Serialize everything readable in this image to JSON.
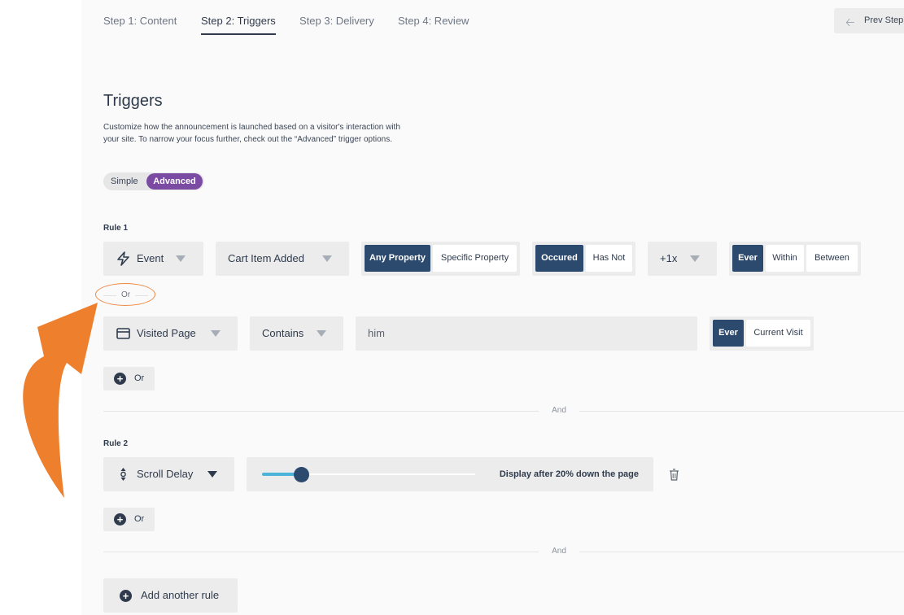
{
  "tabs": [
    {
      "label": "Step 1: Content"
    },
    {
      "label": "Step 2: Triggers"
    },
    {
      "label": "Step 3: Delivery"
    },
    {
      "label": "Step 4: Review"
    }
  ],
  "prev_step": "Prev Step",
  "title": "Triggers",
  "description": "Customize how the announcement is launched based on a visitor's interaction with your site. To narrow your focus further, check out the “Advanced” trigger options.",
  "mode": {
    "simple": "Simple",
    "advanced": "Advanced",
    "selected": "Advanced"
  },
  "rule1": {
    "label": "Rule 1",
    "event_type": "Event",
    "event_value": "Cart Item Added",
    "property": {
      "options": [
        "Any Property",
        "Specific Property"
      ],
      "selected": "Any Property"
    },
    "occurrence": {
      "options": [
        "Occured",
        "Has Not"
      ],
      "selected": "Occured"
    },
    "count": "+1x",
    "timeframe": {
      "options": [
        "Ever",
        "Within",
        "Between"
      ],
      "selected": "Ever"
    },
    "or_label": "Or",
    "condition2": {
      "type": "Visited Page",
      "operator": "Contains",
      "value": "him",
      "scope": {
        "options": [
          "Ever",
          "Current Visit"
        ],
        "selected": "Ever"
      }
    },
    "add_or": "Or"
  },
  "and_label": "And",
  "rule2": {
    "label": "Rule 2",
    "type": "Scroll Delay",
    "slider_percent": 20,
    "slider_text": "Display after 20% down the page",
    "add_or": "Or"
  },
  "add_rule": "Add another rule",
  "colors": {
    "accent": "#7b4aa3",
    "selected": "#2c4a6e",
    "annotation_arrow": "#ee7f2d",
    "slider_fill": "#4cb3d9"
  }
}
